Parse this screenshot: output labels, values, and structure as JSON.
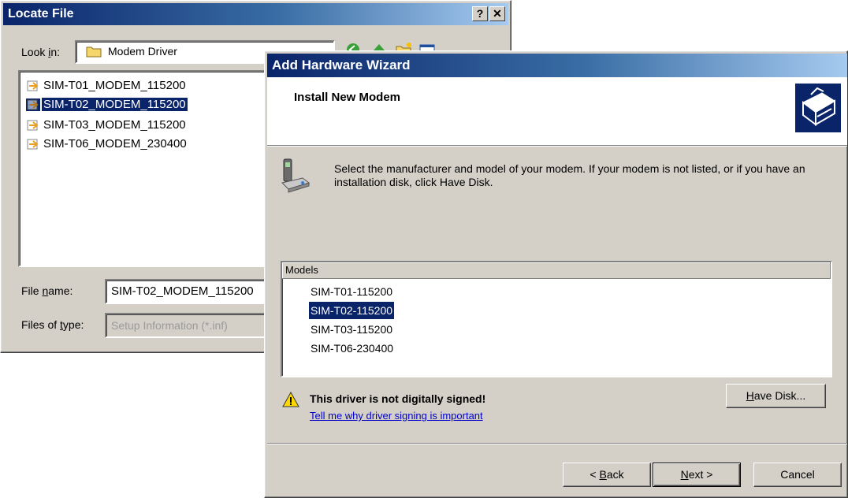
{
  "locate_file": {
    "title": "Locate File",
    "help_btn": "?",
    "close_btn": "✕",
    "look_in_label_pre": "Look ",
    "look_in_label_key": "i",
    "look_in_label_post": "n:",
    "look_in_value": "Modem Driver",
    "files": [
      {
        "name": "SIM-T01_MODEM_115200",
        "selected": false
      },
      {
        "name": "SIM-T02_MODEM_115200",
        "selected": true
      },
      {
        "name": "SIM-T03_MODEM_115200",
        "selected": false
      },
      {
        "name": "SIM-T06_MODEM_230400",
        "selected": false
      }
    ],
    "file_name_label_pre": "File ",
    "file_name_label_key": "n",
    "file_name_label_post": "ame:",
    "file_name_value": "SIM-T02_MODEM_115200",
    "files_type_label_pre": "Files of ",
    "files_type_label_key": "t",
    "files_type_label_post": "ype:",
    "files_type_value": "Setup Information (*.inf)"
  },
  "wizard": {
    "title": "Add Hardware Wizard",
    "heading": "Install New Modem",
    "instruction": "Select the manufacturer and model of your modem. If your modem is not listed, or if you have an installation disk, click Have Disk.",
    "models_header": "Models",
    "models": [
      {
        "name": "SIM-T01-115200",
        "selected": false
      },
      {
        "name": "SIM-T02-115200",
        "selected": true
      },
      {
        "name": "SIM-T03-115200",
        "selected": false
      },
      {
        "name": "SIM-T06-230400",
        "selected": false
      }
    ],
    "warning_text": "This driver is not digitally signed!",
    "warning_link": "Tell me why driver signing is important",
    "have_disk_key": "H",
    "have_disk_rest": "ave Disk...",
    "back_pre": "< ",
    "back_key": "B",
    "back_post": "ack",
    "next_key": "N",
    "next_post": "ext >",
    "cancel": "Cancel"
  }
}
